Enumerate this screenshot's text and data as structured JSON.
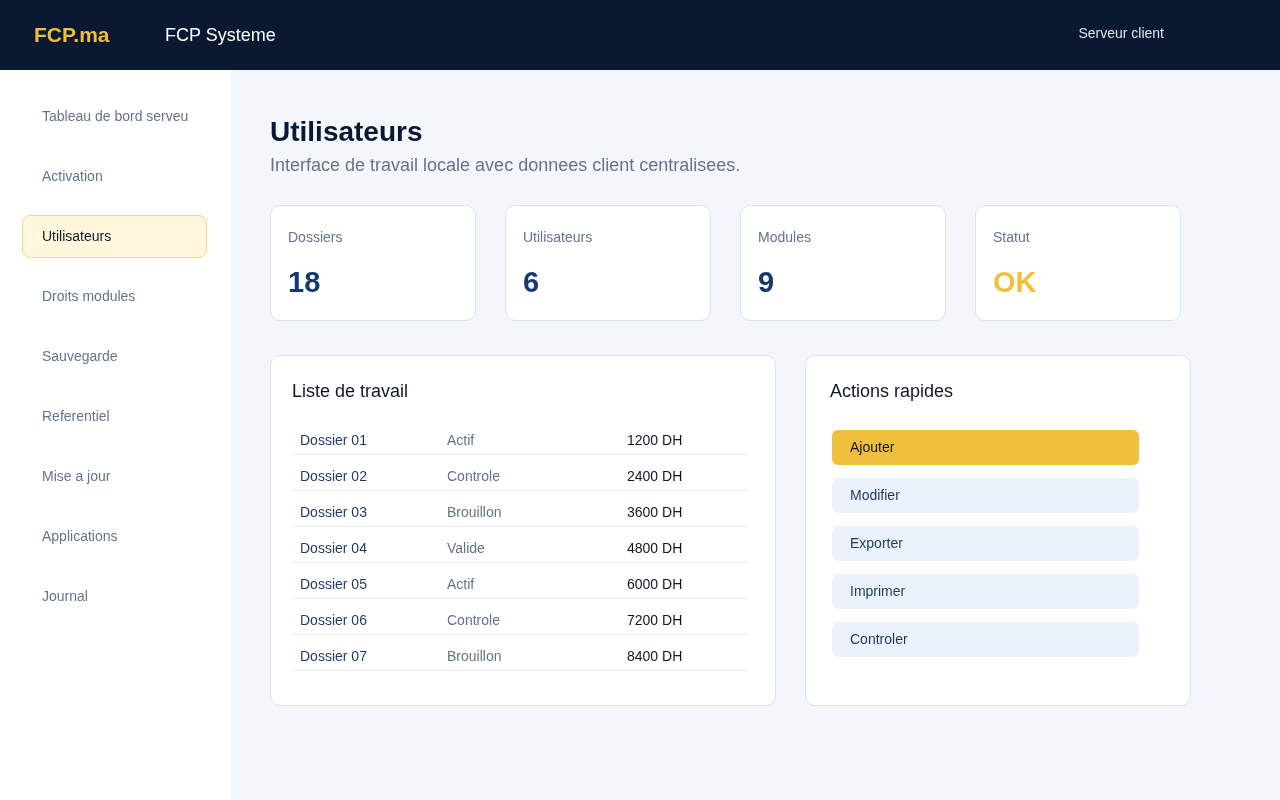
{
  "header": {
    "logo": "FCP.ma",
    "app_title": "FCP Systeme",
    "server_label": "Serveur client"
  },
  "sidebar": {
    "items": [
      {
        "label": "Tableau de bord serveu",
        "selected": false
      },
      {
        "label": "Activation",
        "selected": false
      },
      {
        "label": "Utilisateurs",
        "selected": true
      },
      {
        "label": "Droits modules",
        "selected": false
      },
      {
        "label": "Sauvegarde",
        "selected": false
      },
      {
        "label": "Referentiel",
        "selected": false
      },
      {
        "label": "Mise a jour",
        "selected": false
      },
      {
        "label": "Applications",
        "selected": false
      },
      {
        "label": "Journal",
        "selected": false
      }
    ]
  },
  "page": {
    "title": "Utilisateurs",
    "subtitle": "Interface de travail locale avec donnees client centralisees."
  },
  "stats": [
    {
      "label": "Dossiers",
      "value": "18",
      "kind": "count"
    },
    {
      "label": "Utilisateurs",
      "value": "6",
      "kind": "count"
    },
    {
      "label": "Modules",
      "value": "9",
      "kind": "count"
    },
    {
      "label": "Statut",
      "value": "OK",
      "kind": "status"
    }
  ],
  "work_list": {
    "title": "Liste de travail",
    "rows": [
      {
        "name": "Dossier 01",
        "status": "Actif",
        "amount": "1200 DH"
      },
      {
        "name": "Dossier 02",
        "status": "Controle",
        "amount": "2400 DH"
      },
      {
        "name": "Dossier 03",
        "status": "Brouillon",
        "amount": "3600 DH"
      },
      {
        "name": "Dossier 04",
        "status": "Valide",
        "amount": "4800 DH"
      },
      {
        "name": "Dossier 05",
        "status": "Actif",
        "amount": "6000 DH"
      },
      {
        "name": "Dossier 06",
        "status": "Controle",
        "amount": "7200 DH"
      },
      {
        "name": "Dossier 07",
        "status": "Brouillon",
        "amount": "8400 DH"
      }
    ]
  },
  "quick_actions": {
    "title": "Actions rapides",
    "buttons": [
      {
        "label": "Ajouter",
        "kind": "primary"
      },
      {
        "label": "Modifier",
        "kind": "secondary"
      },
      {
        "label": "Exporter",
        "kind": "secondary"
      },
      {
        "label": "Imprimer",
        "kind": "secondary"
      },
      {
        "label": "Controler",
        "kind": "secondary"
      }
    ]
  }
}
